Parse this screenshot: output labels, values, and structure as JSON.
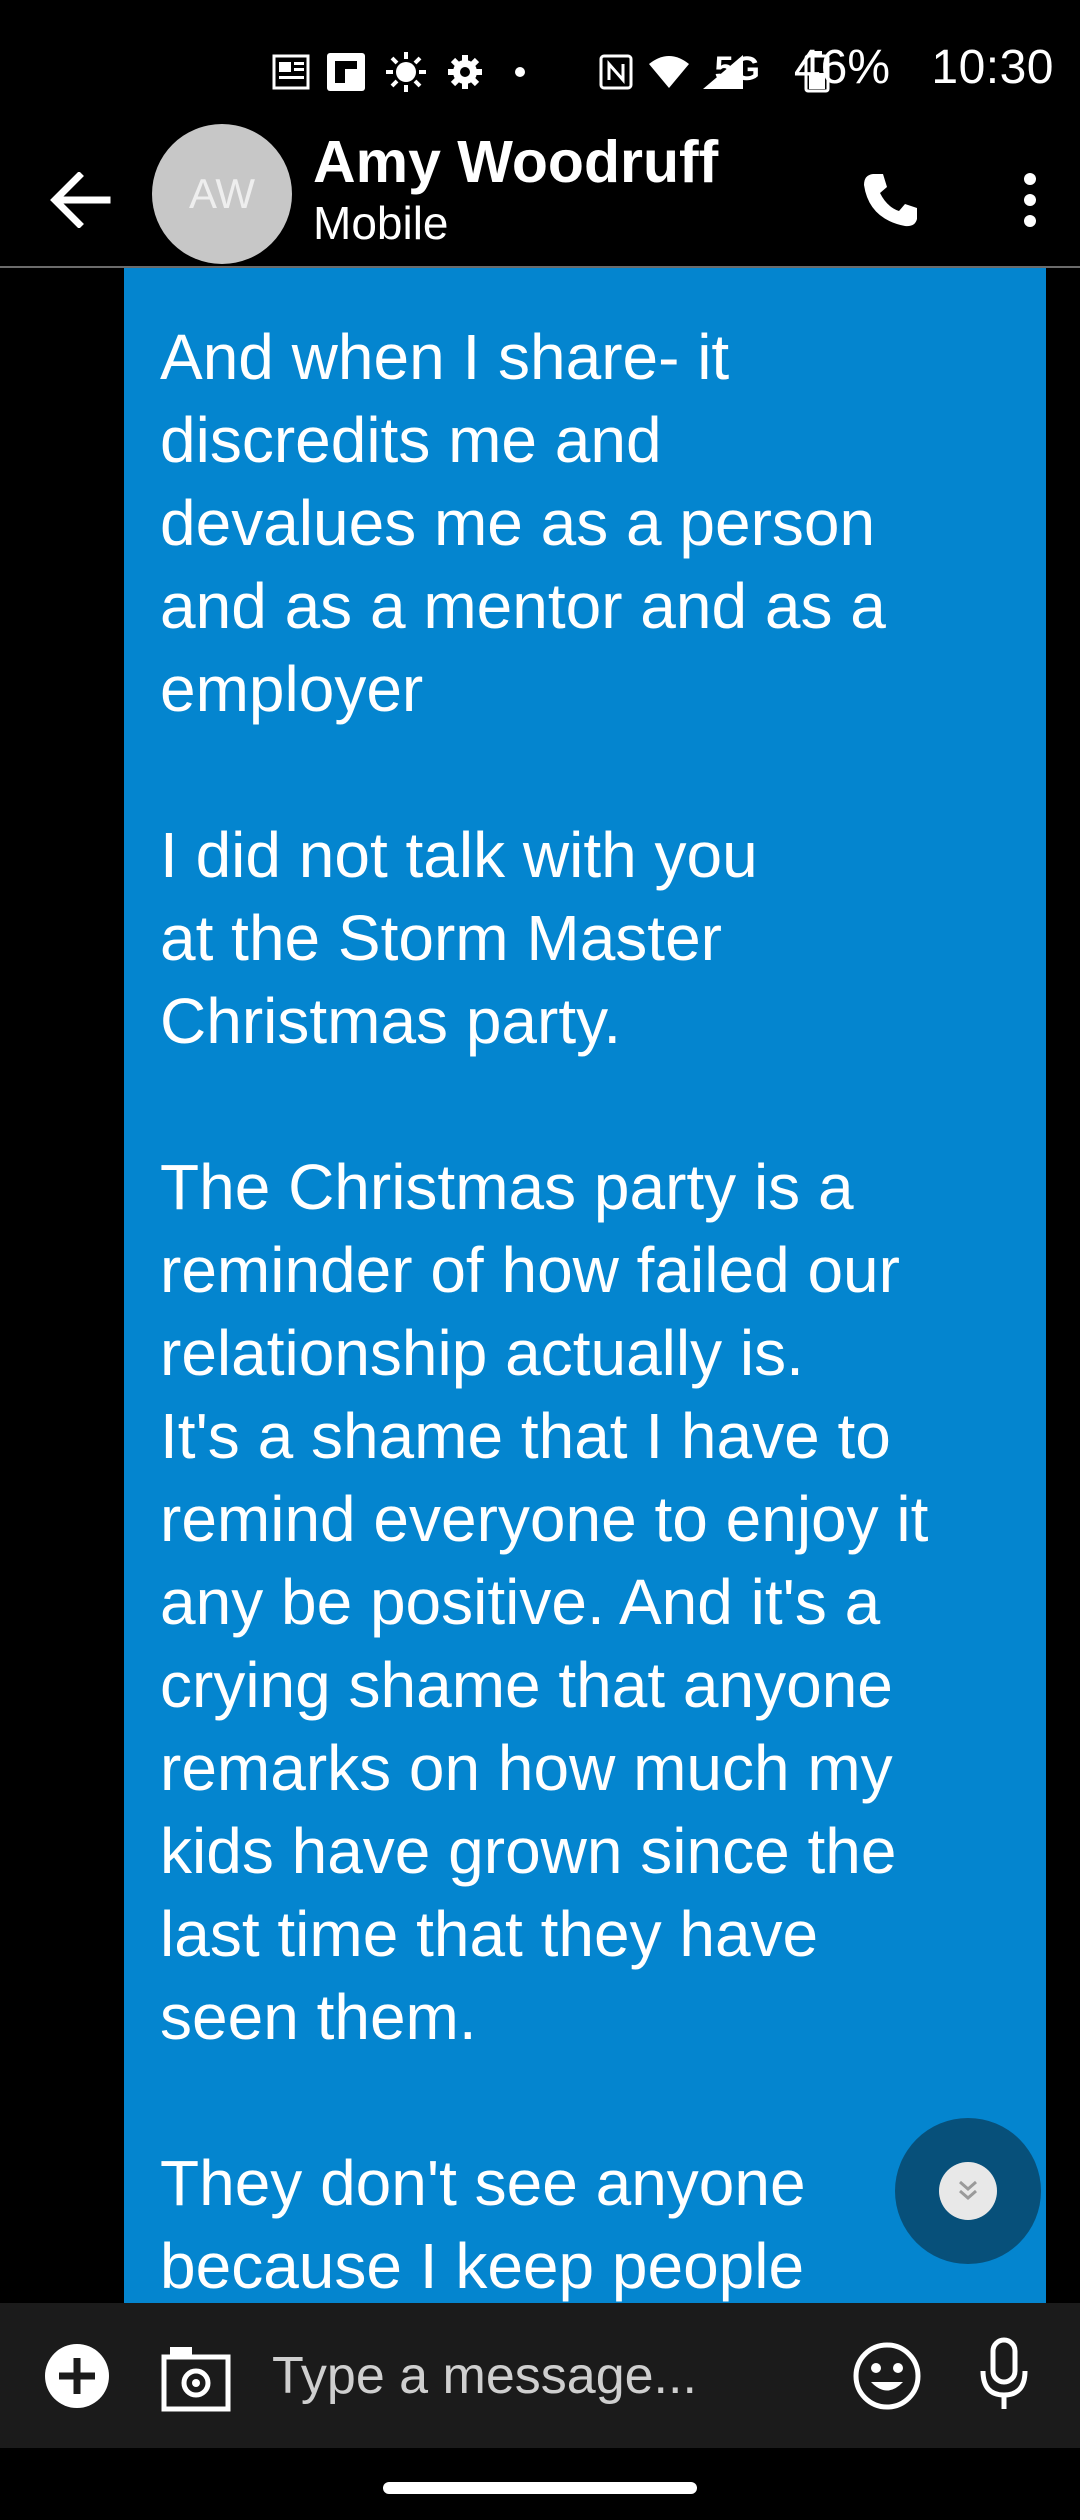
{
  "status_bar": {
    "time": "10:30",
    "battery_percent": "46%",
    "network": "5G",
    "icons": [
      "news-icon",
      "flipboard-icon",
      "brightness-icon",
      "settings-icon",
      "dot-icon",
      "nfc-icon",
      "wifi-icon",
      "signal-icon",
      "battery-icon"
    ]
  },
  "header": {
    "avatar_initials": "AW",
    "contact_name": "Amy Woodruff",
    "contact_sub": "Mobile",
    "icons": [
      "back-arrow-icon",
      "phone-icon",
      "more-vert-icon"
    ]
  },
  "conversation": {
    "messages": [
      {
        "text": "And when I share- it\ndiscredits me and\ndevalues me as a person\nand as a mentor and as a\nemployer\n\nI did not talk with you\nat the Storm Master\nChristmas party.\n\nThe Christmas party is a\nreminder of how failed our\nrelationship actually is.\nIt's a shame that I have to\nremind everyone to enjoy it\nany be positive. And it's a\ncrying shame that anyone\nremarks on how much my\nkids have grown since the\nlast time that they have\nseen them.\n\nThey don't see anyone\nbecause I keep people",
        "color": "#0485cf"
      }
    ]
  },
  "composer": {
    "placeholder": "Type a message...",
    "icons": [
      "add-circle-icon",
      "camera-icon",
      "emoji-icon",
      "mic-icon"
    ]
  },
  "colors": {
    "bubble": "#0485cf",
    "scroll_button": "#07507a",
    "background": "#000000",
    "composer": "#1b1b1b",
    "avatar": "#c7c7c7"
  }
}
